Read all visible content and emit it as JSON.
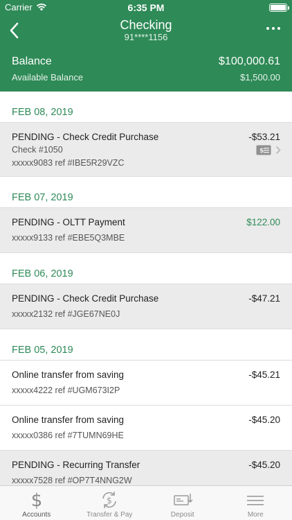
{
  "status_bar": {
    "carrier": "Carrier",
    "time": "6:35 PM"
  },
  "nav": {
    "title": "Checking",
    "account_number": "91****1156"
  },
  "balance": {
    "label": "Balance",
    "value": "$100,000.61",
    "available_label": "Available Balance",
    "available_value": "$1,500.00"
  },
  "groups": [
    {
      "date": "FEB 08, 2019",
      "transactions": [
        {
          "description": "PENDING - Check Credit Purchase",
          "check": "Check #1050",
          "ref": "xxxxx9083 ref #IBE5R29VZC",
          "amount": "-$53.21"
        }
      ]
    },
    {
      "date": "FEB 07, 2019",
      "transactions": [
        {
          "description": "PENDING - OLTT Payment",
          "ref": "xxxxx9133 ref #EBE5Q3MBE",
          "amount": "$122.00"
        }
      ]
    },
    {
      "date": "FEB 06, 2019",
      "transactions": [
        {
          "description": "PENDING - Check Credit Purchase",
          "ref": "xxxxx2132 ref #JGE67NE0J",
          "amount": "-$47.21"
        }
      ]
    },
    {
      "date": "FEB 05, 2019",
      "transactions": [
        {
          "description": "Online transfer from saving",
          "ref": "xxxxx4222 ref #UGM673I2P",
          "amount": "-$45.21"
        },
        {
          "description": "Online transfer from saving",
          "ref": "xxxxx0386 ref #7TUMN69HE",
          "amount": "-$45.20"
        },
        {
          "description": "PENDING - Recurring Transfer",
          "ref": "xxxxx7528 ref #OP7T4NNG2W",
          "amount": "-$45.20"
        }
      ]
    }
  ],
  "tabs": [
    {
      "label": "Accounts",
      "icon": "dollar-icon"
    },
    {
      "label": "Transfer & Pay",
      "icon": "transfer-pay-icon"
    },
    {
      "label": "Deposit",
      "icon": "deposit-icon"
    },
    {
      "label": "More",
      "icon": "menu-icon"
    }
  ],
  "colors": {
    "brand_green": "#2e8a57",
    "pending_row": "#ebebeb",
    "credit": "#2e8a57"
  }
}
